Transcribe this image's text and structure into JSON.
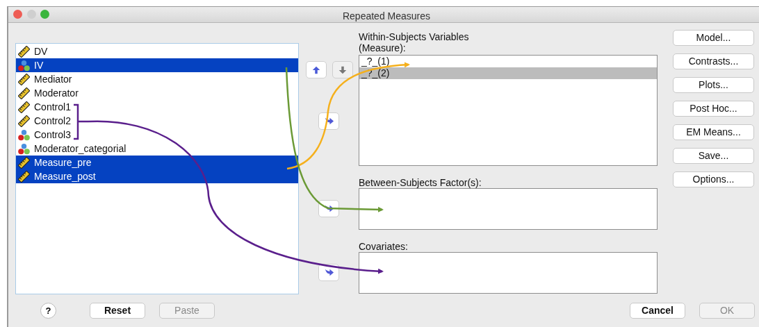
{
  "window": {
    "title": "Repeated Measures"
  },
  "variables": [
    {
      "name": "DV",
      "kind": "scale",
      "selected": false
    },
    {
      "name": "IV",
      "kind": "nominal",
      "selected": true
    },
    {
      "name": "Mediator",
      "kind": "scale",
      "selected": false
    },
    {
      "name": "Moderator",
      "kind": "scale",
      "selected": false
    },
    {
      "name": "Control1",
      "kind": "scale",
      "selected": false
    },
    {
      "name": "Control2",
      "kind": "scale",
      "selected": false
    },
    {
      "name": "Control3",
      "kind": "nominal",
      "selected": false
    },
    {
      "name": "Moderator_categorial",
      "kind": "nominal",
      "selected": false
    },
    {
      "name": "Measure_pre",
      "kind": "scale",
      "selected": true
    },
    {
      "name": "Measure_post",
      "kind": "scale",
      "selected": true
    }
  ],
  "order_buttons": [
    {
      "kind": "up",
      "disabled": false
    },
    {
      "kind": "down",
      "disabled": true
    }
  ],
  "within_subjects": {
    "label": "Within-Subjects Variables (Measure):",
    "items": [
      {
        "text": "_?_(1)",
        "selected": false
      },
      {
        "text": "_?_(2)",
        "selected": true
      }
    ]
  },
  "between_subjects": {
    "label": "Between-Subjects Factor(s):"
  },
  "covariates": {
    "label": "Covariates:"
  },
  "side_buttons": [
    "Model...",
    "Contrasts...",
    "Plots...",
    "Post Hoc...",
    "EM Means...",
    "Save...",
    "Options..."
  ],
  "footer": {
    "help": "?",
    "buttons": [
      {
        "label": "Reset",
        "disabled": false
      },
      {
        "label": "Paste",
        "disabled": true
      }
    ]
  },
  "dialog_buttons": [
    {
      "label": "Cancel",
      "disabled": false
    },
    {
      "label": "OK",
      "disabled": true
    }
  ]
}
